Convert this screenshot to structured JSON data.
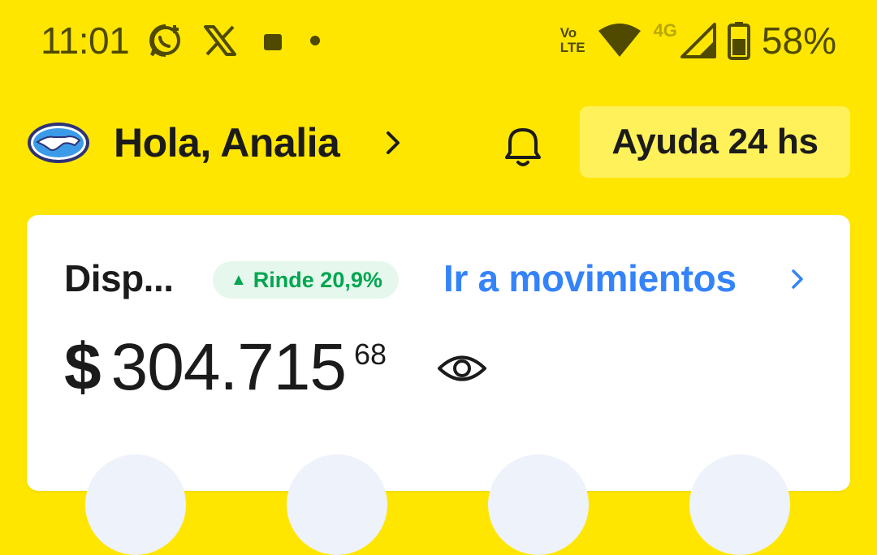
{
  "status_bar": {
    "time": "11:01",
    "volte_top": "Vo",
    "volte_bottom": "LTE",
    "network": "4G",
    "battery": "58%",
    "icons": [
      "whatsapp-icon",
      "x-icon",
      "notification-square-icon",
      "dot-icon",
      "volte-icon",
      "wifi-icon",
      "4g-icon",
      "signal-icon",
      "battery-icon"
    ]
  },
  "header": {
    "greeting": "Hola, Analia",
    "help_label": "Ayuda 24 hs",
    "icons": [
      "mercadolibre-handshake-logo",
      "chevron-right-icon",
      "bell-icon"
    ]
  },
  "account_card": {
    "label": "Disp...",
    "yield_badge": "Rinde 20,9%",
    "yield_arrow": "▲",
    "movements_link": "Ir a movimientos",
    "currency": "$",
    "amount": "304.715",
    "cents": "68",
    "icons": [
      "eye-icon",
      "chevron-right-icon"
    ]
  },
  "colors": {
    "brand_yellow": "#FFE600",
    "help_button_bg": "#FFF159",
    "link_blue": "#3483FA",
    "yield_green": "#00A650",
    "yield_badge_bg": "#E6F7EE"
  }
}
